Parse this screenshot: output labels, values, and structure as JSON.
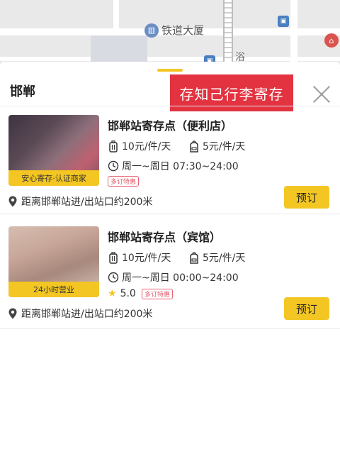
{
  "map": {
    "poi_label": "铁道大厦",
    "street_char": "浴"
  },
  "sheet": {
    "city": "邯郸",
    "banner": "存知己行李寄存"
  },
  "stores": [
    {
      "name": "邯郸站寄存点（便利店）",
      "thumb_tag": "安心寄存·认证商家",
      "luggage_price": "10元/件/天",
      "bag_price": "5元/件/天",
      "hours": "周一~周日 07:30~24:00",
      "promo": "多订特惠",
      "rating": "",
      "distance": "距离邯郸站进/出站口约200米",
      "action": "预订"
    },
    {
      "name": "邯郸站寄存点（宾馆）",
      "thumb_tag": "24小时营业",
      "luggage_price": "10元/件/天",
      "bag_price": "5元/件/天",
      "hours": "周一~周日 00:00~24:00",
      "promo": "多订特惠",
      "rating": "5.0",
      "distance": "距离邯郸站进/出站口约200米",
      "action": "预订"
    }
  ],
  "colors": {
    "accent_yellow": "#f3c623",
    "banner_red": "#e33240",
    "promo_red": "#e05a68"
  }
}
